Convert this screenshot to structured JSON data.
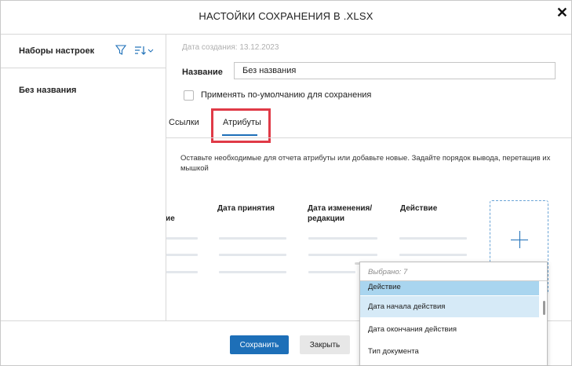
{
  "dialog": {
    "title": "НАСТОЙКИ СОХРАНЕНИЯ В .XLSX",
    "close_glyph": "✕"
  },
  "sidebar": {
    "title": "Наборы настроек",
    "filter_icon": "filter-icon",
    "sort_icon": "sort-icon",
    "items": [
      {
        "label": "Без названия"
      }
    ]
  },
  "main": {
    "created": "Дата создания: 13.12.2023",
    "name_label": "Название",
    "name_value": "Без названия",
    "default_checkbox_label": "Применять по-умолчанию для сохранения",
    "tabs": [
      {
        "label": "Ссылки"
      },
      {
        "label": "Атрибуты"
      }
    ],
    "active_tab": "Атрибуты",
    "hint": "Оставьте необходимые для отчета атрибуты или добавьте новые. Задайте порядок вывода, перетащив их мышкой",
    "columns": [
      {
        "label": "ние"
      },
      {
        "label": "Дата принятия"
      },
      {
        "label": "Дата изменения/\nредакции"
      },
      {
        "label": "Действие"
      }
    ],
    "add_column_icon": "plus-icon"
  },
  "dropdown": {
    "selected_count": "Выбрано: 7",
    "items": [
      {
        "label": "Действие",
        "selected": true
      },
      {
        "label": "Дата начала действия",
        "selected": true
      },
      {
        "label": "Дата окончания действия",
        "selected": false
      },
      {
        "label": "Тип документа",
        "selected": false
      }
    ]
  },
  "footer": {
    "save_label": "Сохранить",
    "close_label": "Закрыть"
  },
  "colors": {
    "accent": "#1d6fb8",
    "highlight": "#e03a47",
    "selected_row": "#d6eaf7",
    "selected_row_strong": "#a9d5ef"
  }
}
